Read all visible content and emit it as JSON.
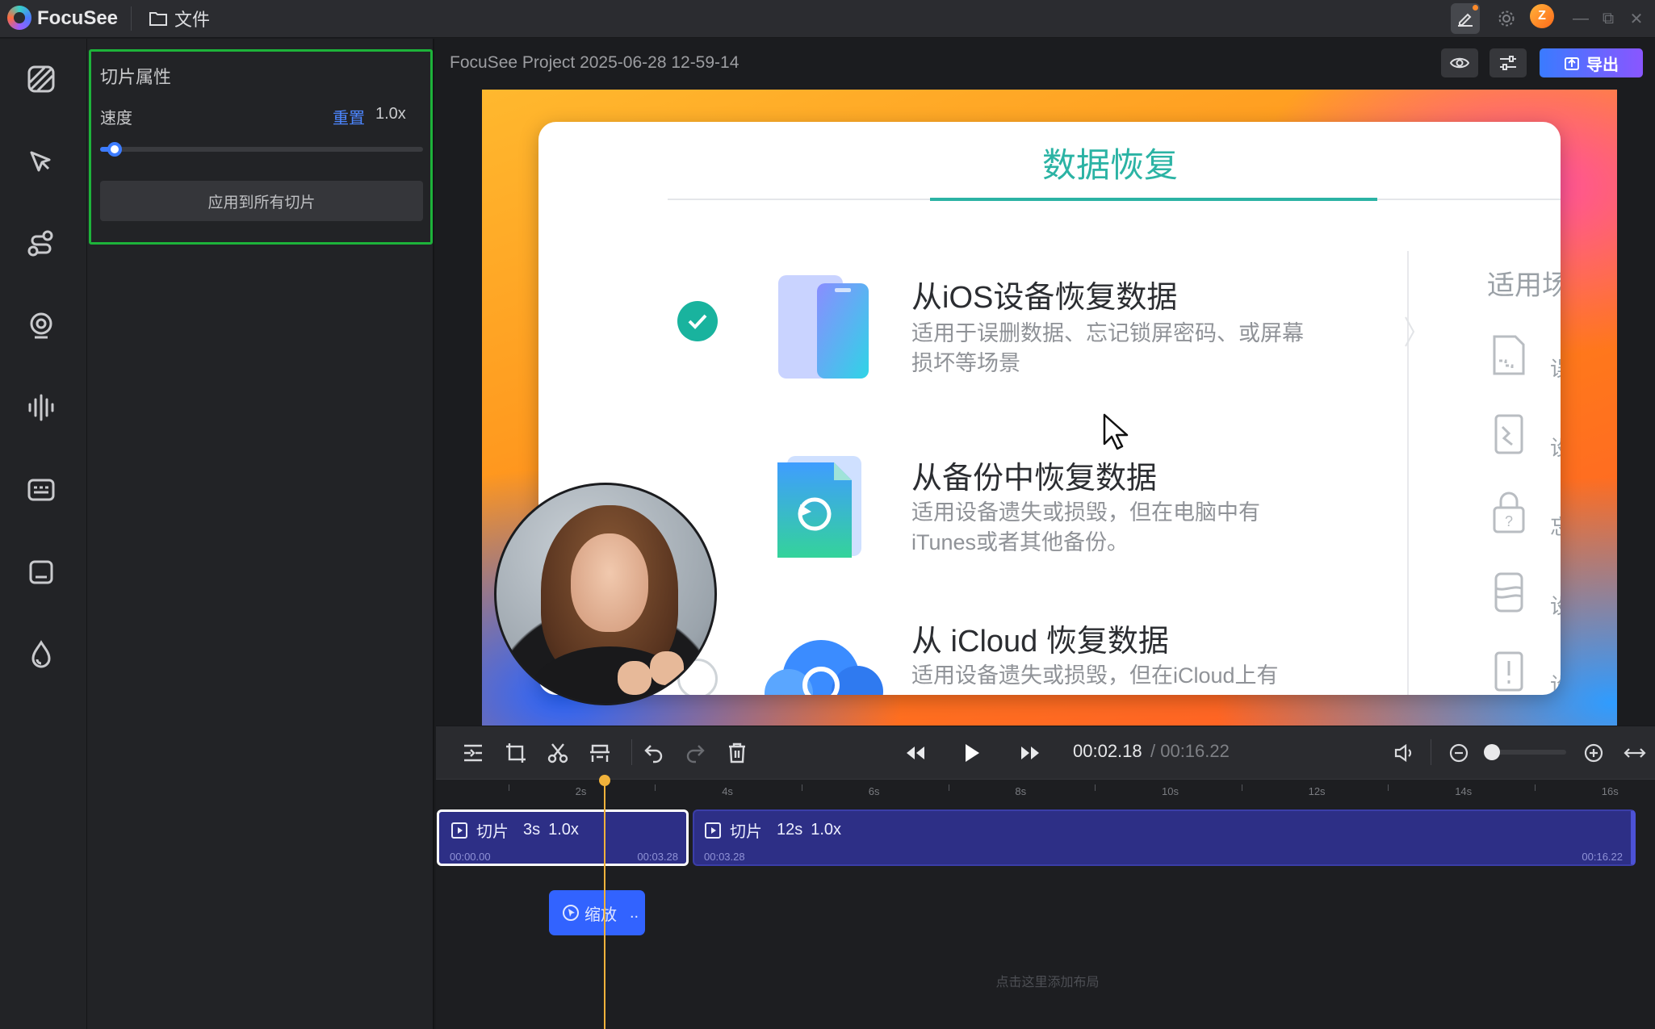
{
  "app": {
    "name": "FocuSee",
    "file_menu": "文件"
  },
  "titlebar": {
    "avatar_letter": "Z"
  },
  "rail": {
    "items": [
      "background-icon",
      "cursor-icon",
      "motion-path-icon",
      "camera-icon",
      "audio-icon",
      "captions-icon",
      "layout-icon",
      "watermark-icon"
    ]
  },
  "panel": {
    "title": "切片属性",
    "speed_label": "速度",
    "reset_label": "重置",
    "speed_value": "1.0x",
    "speed_slider_fraction": 0.05,
    "apply_button": "应用到所有切片"
  },
  "preview": {
    "project_title": "FocuSee Project 2025-06-28 12-59-14",
    "export_label": "导出"
  },
  "recording": {
    "heading": "数据恢复",
    "options": [
      {
        "title": "从iOS设备恢复数据",
        "desc": "适用于误删数据、忘记锁屏密码、或屏幕损坏等场景",
        "selected": true
      },
      {
        "title": "从备份中恢复数据",
        "desc": "适用设备遗失或损毁，但在电脑中有iTunes或者其他备份。"
      },
      {
        "title": "从 iCloud 恢复数据",
        "desc": "适用设备遗失或损毁，但在iCloud上有"
      }
    ],
    "side_heading": "适用场",
    "side_chars": [
      "误",
      "设",
      "忘",
      "设",
      "设"
    ]
  },
  "playback": {
    "current_time": "00:02.18",
    "total_time": "/ 00:16.22"
  },
  "timeline": {
    "ruler": [
      "2s",
      "4s",
      "6s",
      "8s",
      "10s",
      "12s",
      "14s",
      "16s"
    ],
    "clips": [
      {
        "label": "切片",
        "duration": "3s",
        "speed": "1.0x",
        "start": "00:00.00",
        "end": "00:03.28"
      },
      {
        "label": "切片",
        "duration": "12s",
        "speed": "1.0x",
        "start": "00:03.28",
        "end": "00:16.22"
      }
    ],
    "zoom_chip": "缩放",
    "zoom_chip_more": "..",
    "layout_hint": "点击这里添加布局"
  }
}
